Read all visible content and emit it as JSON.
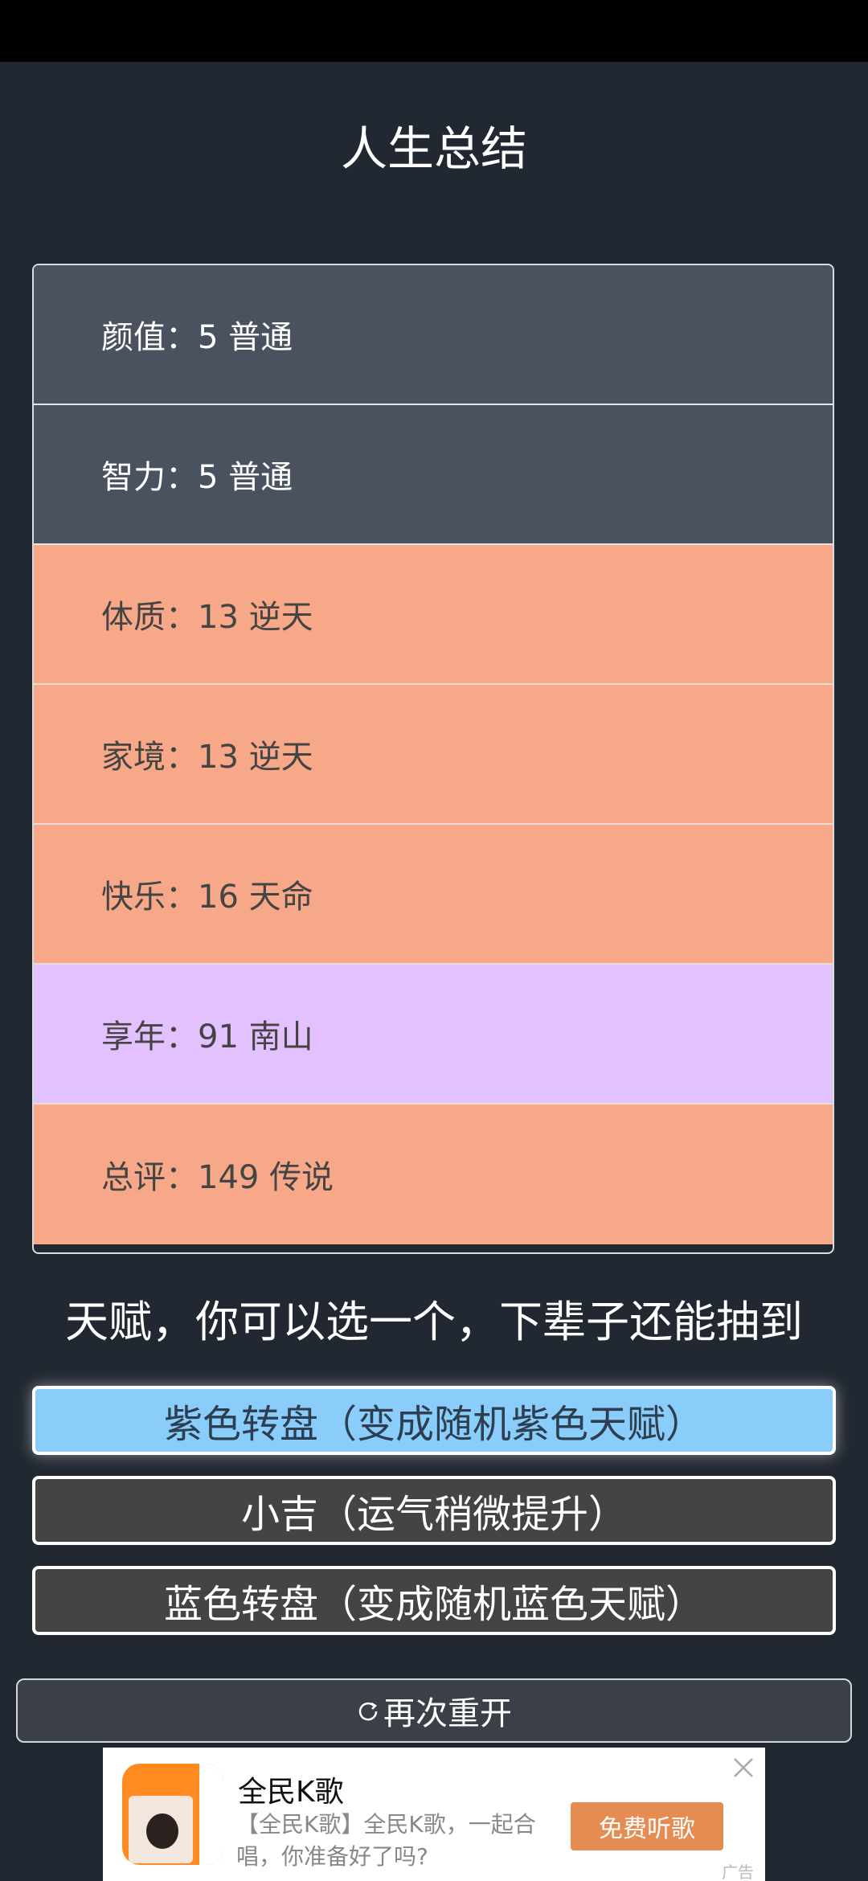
{
  "page": {
    "title": "人生总结"
  },
  "summary": {
    "rows": [
      {
        "label": "颜值：",
        "value": "5 普通"
      },
      {
        "label": "智力：",
        "value": "5 普通"
      },
      {
        "label": "体质：",
        "value": "13 逆天"
      },
      {
        "label": "家境：",
        "value": "13 逆天"
      },
      {
        "label": "快乐：",
        "value": "16 天命"
      },
      {
        "label": "享年：",
        "value": "91 南山"
      },
      {
        "label": "总评：",
        "value": "149 传说"
      }
    ]
  },
  "talents": {
    "heading": "天赋，你可以选一个，下辈子还能抽到",
    "options": [
      {
        "label": "紫色转盘（变成随机紫色天赋）",
        "selected": true
      },
      {
        "label": "小吉（运气稍微提升）",
        "selected": false
      },
      {
        "label": "蓝色转盘（变成随机蓝色天赋）",
        "selected": false
      }
    ]
  },
  "restart": {
    "label": "再次重开",
    "icon": "refresh-icon"
  },
  "ad": {
    "title": "全民K歌",
    "description": "【全民K歌】全民K歌，一起合唱，你准备好了吗?",
    "cta": "免费听歌",
    "tag": "广告",
    "icon": "close-icon"
  },
  "colors": {
    "background": "#222831",
    "row_normal": "#4a5260",
    "row_orange": "#f6a888",
    "row_purple": "#e3c0fe",
    "selected_option": "#8acdfa",
    "option": "#444444",
    "cta": "#e68c52"
  }
}
